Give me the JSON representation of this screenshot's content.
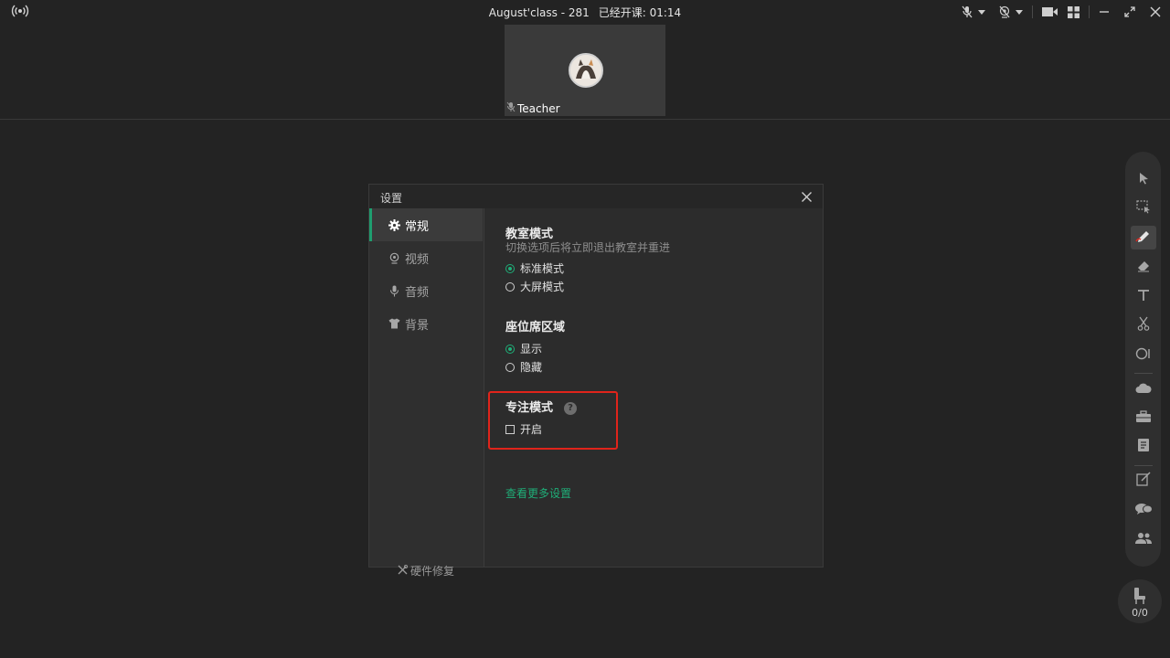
{
  "topbar": {
    "class_name": "August'class - 281",
    "class_timer": "已经开课: 01:14"
  },
  "video": {
    "name": "Teacher"
  },
  "dialog": {
    "title": "设置",
    "sidebar": {
      "items": [
        {
          "label": "常规",
          "icon": "gear-icon",
          "active": true
        },
        {
          "label": "视频",
          "icon": "camera-icon",
          "active": false
        },
        {
          "label": "音频",
          "icon": "microphone-icon",
          "active": false
        },
        {
          "label": "背景",
          "icon": "shirt-icon",
          "active": false
        }
      ],
      "footer": "硬件修复"
    },
    "classroom_mode": {
      "title": "教室模式",
      "subtitle": "切换选项后将立即退出教室并重进",
      "options": [
        {
          "label": "标准模式",
          "selected": true
        },
        {
          "label": "大屏模式",
          "selected": false
        }
      ]
    },
    "seat_area": {
      "title": "座位席区域",
      "options": [
        {
          "label": "显示",
          "selected": true
        },
        {
          "label": "隐藏",
          "selected": false
        }
      ]
    },
    "focus_mode": {
      "title": "专注模式",
      "help": "?",
      "checkbox_label": "开启",
      "checked": false
    },
    "more_link": "查看更多设置"
  },
  "toolbar": {
    "tools": [
      "pointer-icon",
      "area-select-icon",
      "pen-icon",
      "eraser-icon",
      "text-icon",
      "scissors-icon",
      "shape-icon",
      "cloud-icon",
      "toolbox-icon",
      "courseware-icon",
      "edit-note-icon",
      "chat-icon",
      "users-icon"
    ]
  },
  "seat_button": {
    "count": "0/0"
  },
  "colors": {
    "accent": "#1fae78",
    "highlight_box": "#e0241b",
    "background": "#232323"
  }
}
